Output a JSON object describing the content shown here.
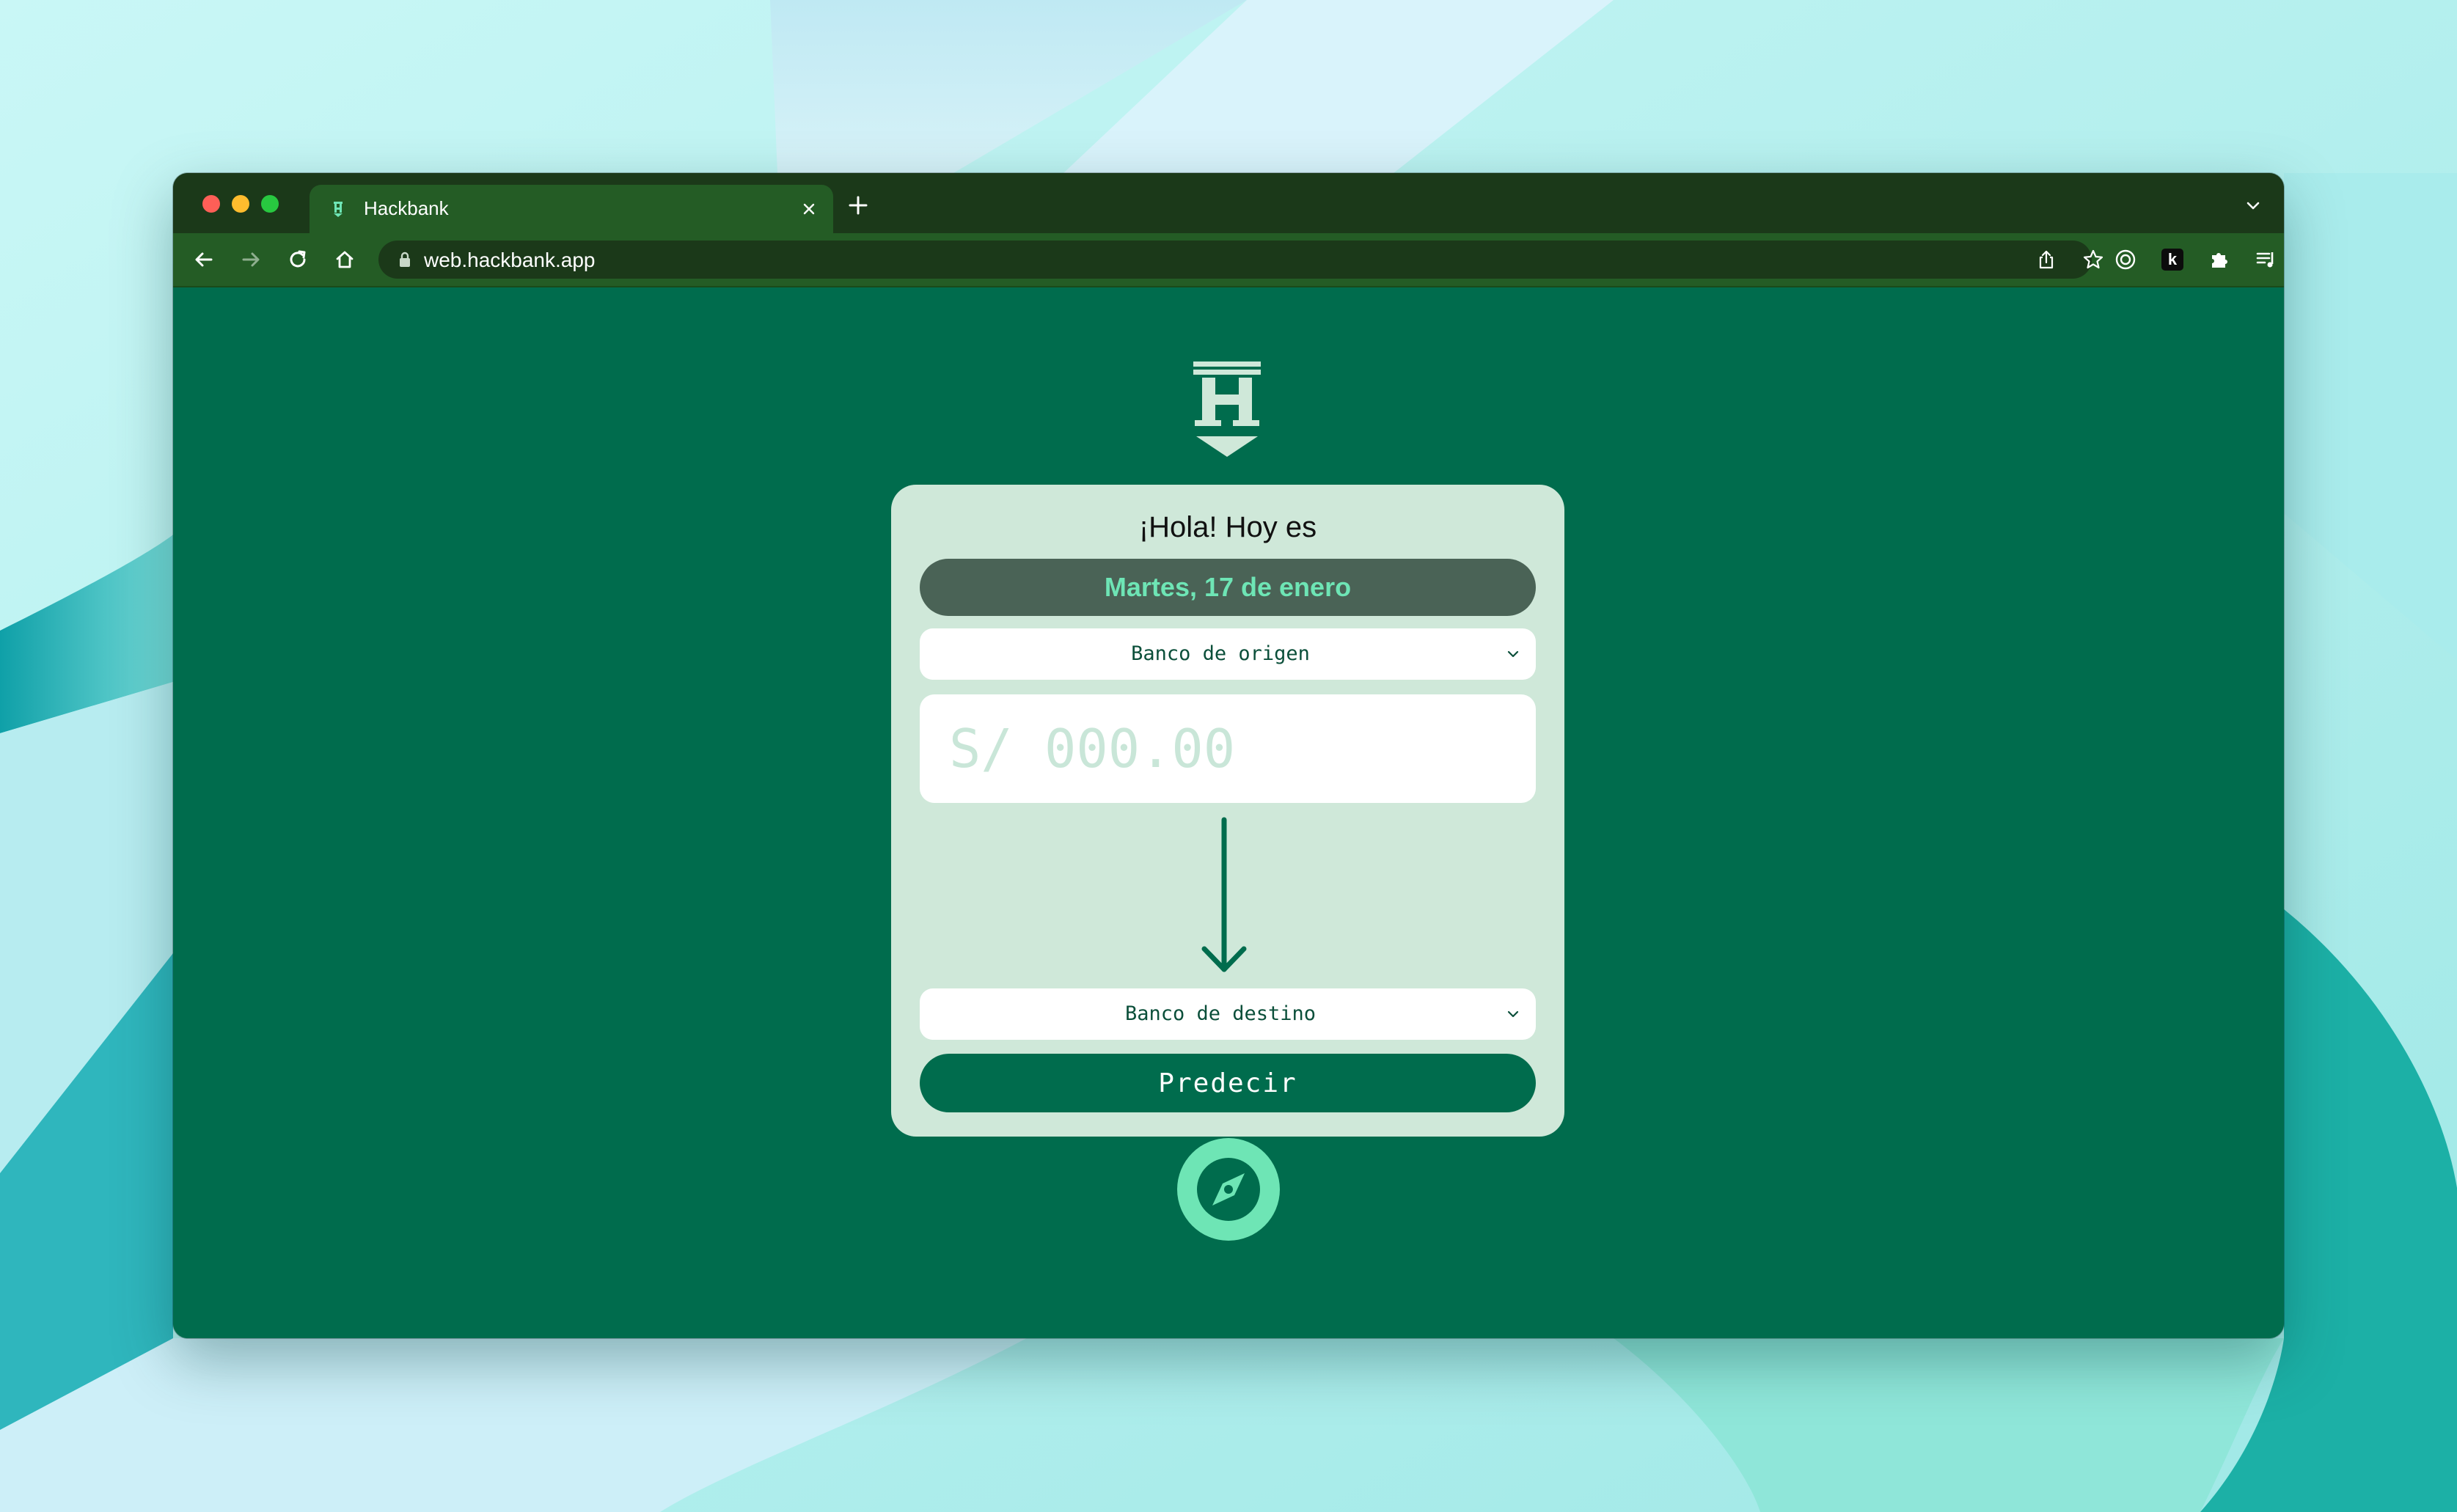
{
  "browser": {
    "tab_title": "Hackbank",
    "url": "web.hackbank.app",
    "extension_badge": "k"
  },
  "page": {
    "greeting": "¡Hola! Hoy es",
    "date": "Martes, 17 de enero",
    "origin_select": "Banco de origen",
    "amount_placeholder": "S/ 000.00",
    "destination_select": "Banco de destino",
    "predict_button": "Predecir"
  },
  "colors": {
    "page_background": "#006c4d",
    "card_background": "#cfe8d9",
    "accent_mint": "#6ee5b5",
    "date_pill": "#4a6356",
    "browser_chrome": "#245c25"
  },
  "icons": {
    "logo": "hackbank-h-arrow-logo",
    "transfer": "arrow-down-icon",
    "explore": "compass-icon"
  }
}
